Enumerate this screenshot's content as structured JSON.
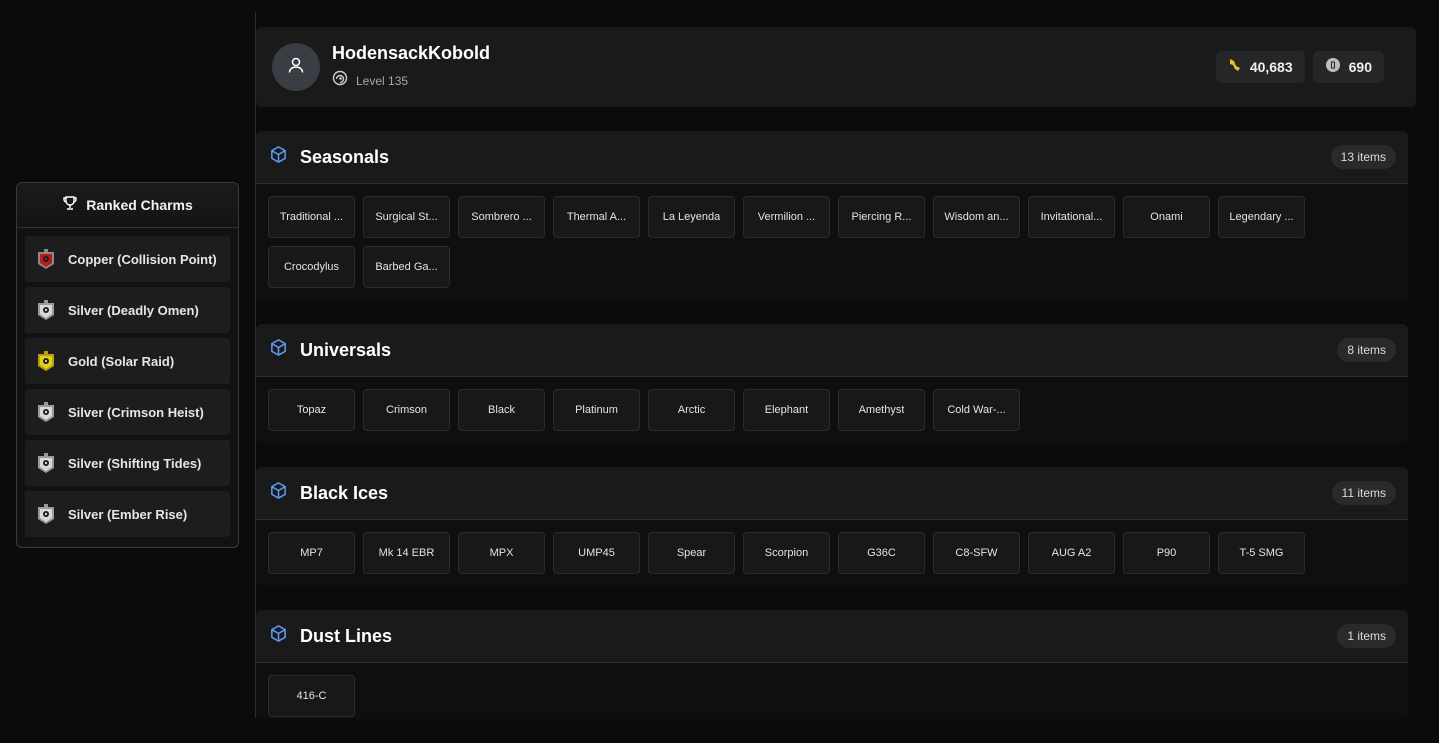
{
  "sidebar": {
    "title": "Ranked Charms",
    "items": [
      {
        "label": "Copper (Collision Point)",
        "tier": "copper"
      },
      {
        "label": "Silver (Deadly Omen)",
        "tier": "silver"
      },
      {
        "label": "Gold (Solar Raid)",
        "tier": "gold"
      },
      {
        "label": "Silver (Crimson Heist)",
        "tier": "silver"
      },
      {
        "label": "Silver (Shifting Tides)",
        "tier": "silver"
      },
      {
        "label": "Silver (Ember Rise)",
        "tier": "silver"
      }
    ]
  },
  "profile": {
    "username": "HodensackKobold",
    "level": "Level 135",
    "renown": "40,683",
    "credits": "690"
  },
  "sections": [
    {
      "title": "Seasonals",
      "count": "13 items",
      "items": [
        "Traditional ...",
        "Surgical St...",
        "Sombrero ...",
        "Thermal A...",
        "La Leyenda",
        "Vermilion ...",
        "Piercing R...",
        "Wisdom an...",
        "Invitational...",
        "Onami",
        "Legendary ...",
        "Crocodylus",
        "Barbed Ga..."
      ]
    },
    {
      "title": "Universals",
      "count": "8 items",
      "items": [
        "Topaz",
        "Crimson",
        "Black",
        "Platinum",
        "Arctic",
        "Elephant",
        "Amethyst",
        "Cold War-..."
      ]
    },
    {
      "title": "Black Ices",
      "count": "11 items",
      "items": [
        "MP7",
        "Mk 14 EBR",
        "MPX",
        "UMP45",
        "Spear",
        "Scorpion",
        "G36C",
        "C8-SFW",
        "AUG A2",
        "P90",
        "T-5 SMG"
      ]
    },
    {
      "title": "Dust Lines",
      "count": "1 items",
      "items": [
        "416-C"
      ]
    }
  ],
  "colors": {
    "accent_icon": "#5b9cf5",
    "renown": "#e8c21a"
  }
}
